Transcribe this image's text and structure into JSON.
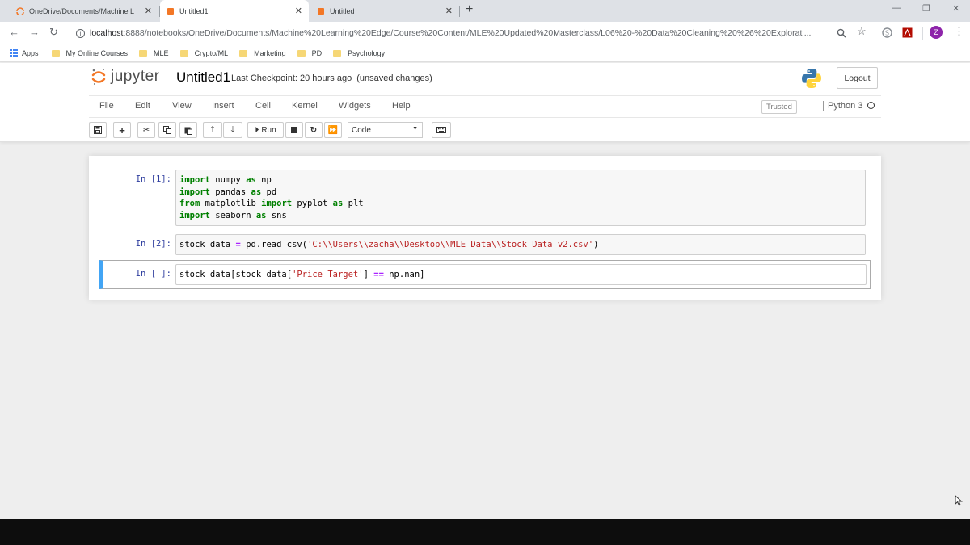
{
  "browser": {
    "tabs": [
      {
        "title": "OneDrive/Documents/Machine L",
        "close": "✕"
      },
      {
        "title": "Untitled1",
        "close": "✕"
      },
      {
        "title": "Untitled",
        "close": "✕"
      }
    ],
    "new_tab": "+",
    "url_host": "localhost",
    "url_path": ":8888/notebooks/OneDrive/Documents/Machine%20Learning%20Edge/Course%20Content/MLE%20Updated%20Masterclass/L06%20-%20Data%20Cleaning%20%26%20Explorati...",
    "profile_initial": "Z",
    "bookmarks": [
      "Apps",
      "My Online Courses",
      "MLE",
      "Crypto/ML",
      "Marketing",
      "PD",
      "Psychology"
    ]
  },
  "jupyter": {
    "wordmark": "jupyter",
    "notebook_name": "Untitled1",
    "checkpoint": "Last Checkpoint: 20 hours ago",
    "unsaved": "(unsaved changes)",
    "logout": "Logout",
    "menu": [
      "File",
      "Edit",
      "View",
      "Insert",
      "Cell",
      "Kernel",
      "Widgets",
      "Help"
    ],
    "trusted": "Trusted",
    "kernel": "Python 3",
    "run_label": "Run",
    "cell_type": "Code"
  },
  "cells": [
    {
      "prompt": "In [1]:"
    },
    {
      "prompt": "In [2]:"
    },
    {
      "prompt": "In [ ]:"
    }
  ],
  "code": {
    "c1_l1_kw": "import",
    "c1_l1_rest": " numpy ",
    "c1_l1_as": "as",
    "c1_l1_alias": " np",
    "c1_l2_kw": "import",
    "c1_l2_rest": " pandas ",
    "c1_l2_as": "as",
    "c1_l2_alias": " pd",
    "c1_l3_from": "from",
    "c1_l3_mod": " matplotlib ",
    "c1_l3_imp": "import",
    "c1_l3_rest": " pyplot ",
    "c1_l3_as": "as",
    "c1_l3_alias": " plt",
    "c1_l4_kw": "import",
    "c1_l4_rest": " seaborn ",
    "c1_l4_as": "as",
    "c1_l4_alias": " sns",
    "c2_a": "stock_data ",
    "c2_eq": "=",
    "c2_b": " pd.read_csv(",
    "c2_str": "'C:\\\\Users\\\\zacha\\\\Desktop\\\\MLE Data\\\\Stock Data_v2.csv'",
    "c2_c": ")",
    "c3_a": "stock_data[stock_data[",
    "c3_str": "'Price Target'",
    "c3_b": "] ",
    "c3_eq": "==",
    "c3_c": " np.nan]"
  },
  "colors": {
    "jupyter_orange": "#f37726",
    "selected_cell_border": "#42a5f5",
    "prompt_blue": "#303f9f",
    "keyword_green": "#008000",
    "string_red": "#ba2121"
  }
}
